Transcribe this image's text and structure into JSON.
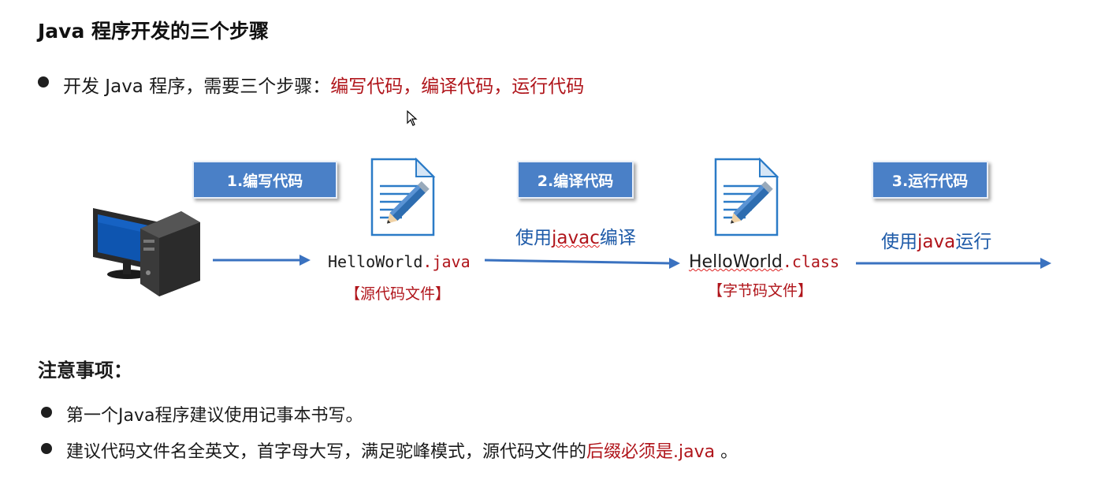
{
  "title": "Java 程序开发的三个步骤",
  "intro": {
    "prefix": "开发 Java 程序，需要三个步骤：",
    "highlight": "编写代码，编译代码，运行代码"
  },
  "diagram": {
    "steps": [
      "1.编写代码",
      "2.编译代码",
      "3.运行代码"
    ],
    "source_file": {
      "name": "HelloWorld",
      "ext": ".java",
      "type": "【源代码文件】"
    },
    "class_file": {
      "name": "HelloWorld",
      "ext": ".class",
      "type": "【字节码文件】"
    },
    "compile": {
      "pre": "使用",
      "cmd": "javac",
      "post": "编译"
    },
    "run": {
      "pre": "使用",
      "cmd": "java",
      "post": "运行"
    }
  },
  "notes": {
    "title": "注意事项：",
    "items": [
      {
        "text": "第一个Java程序建议使用记事本书写。"
      },
      {
        "text": "建议代码文件名全英文，首字母大写，满足驼峰模式，源代码文件的",
        "highlight": "后缀必须是.java",
        "tail": " 。"
      }
    ]
  },
  "colors": {
    "accent_red": "#b0151b",
    "accent_blue": "#1d5aa8",
    "step_box": "#4a80c7"
  },
  "icons": [
    "computer-icon",
    "document-pencil-icon",
    "document-pencil-icon",
    "mouse-cursor-icon"
  ]
}
